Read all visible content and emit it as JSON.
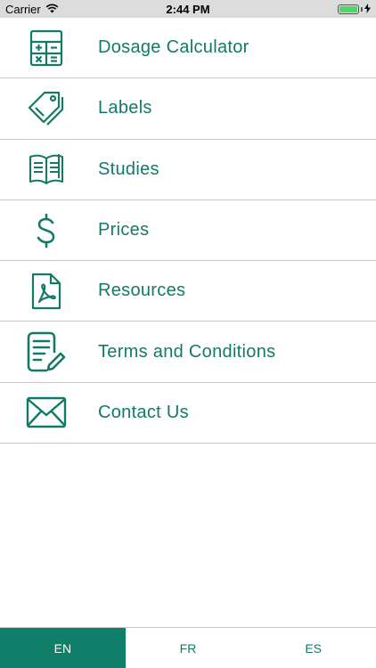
{
  "status_bar": {
    "carrier": "Carrier",
    "time": "2:44 PM",
    "battery_level": 1.0
  },
  "menu": {
    "items": [
      {
        "label": "Dosage Calculator",
        "icon": "calculator-icon"
      },
      {
        "label": "Labels",
        "icon": "tag-icon"
      },
      {
        "label": "Studies",
        "icon": "book-icon"
      },
      {
        "label": "Prices",
        "icon": "dollar-icon"
      },
      {
        "label": "Resources",
        "icon": "pdf-document-icon"
      },
      {
        "label": "Terms and Conditions",
        "icon": "document-edit-icon"
      },
      {
        "label": "Contact Us",
        "icon": "envelope-icon"
      }
    ]
  },
  "language_bar": {
    "options": [
      {
        "label": "EN",
        "active": true
      },
      {
        "label": "FR",
        "active": false
      },
      {
        "label": "ES",
        "active": false
      }
    ]
  },
  "colors": {
    "accent": "#137a68",
    "active_tab": "#0f7f6a",
    "status_bar_bg": "#dcdcdc",
    "divider": "#c8c8c8"
  }
}
